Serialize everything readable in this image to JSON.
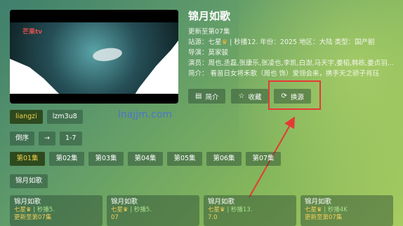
{
  "poster": {
    "channel_logo": "芒果tv"
  },
  "detail": {
    "title": "锦月如歌",
    "update": "更新至第07集",
    "meta_line": "站源：七星",
    "meta_rest": "| 秒播12.   年份：2025   地区：大陆   类型：国产剧",
    "director": "导演：莫家骏",
    "cast": "演员：周也,丞磊,张康乐,张凌也,李凯,白澍,马天宇,姜韬,韩栋,姜贞羽...",
    "intro": "简介：     看苗日女将禾歌（周也 饰）爱领会来，携手天之骄子肖珏"
  },
  "actions": [
    {
      "icon": "doc-icon",
      "glyph": "▤",
      "label": "简介"
    },
    {
      "icon": "star-icon",
      "glyph": "☆",
      "label": "收藏"
    },
    {
      "icon": "refresh-icon",
      "glyph": "⟳",
      "label": "换源"
    }
  ],
  "sources": [
    "liangzi",
    "lzm3u8"
  ],
  "watermark": "lnajjm.com",
  "sort": {
    "label": "倒序",
    "arrow": "→",
    "range": "1-7"
  },
  "episodes": [
    "第01集",
    "第02集",
    "第03集",
    "第04集",
    "第05集",
    "第06集",
    "第07集"
  ],
  "series_name": "锦月如歌",
  "cards": [
    {
      "title": "锦月如歌",
      "star_src": "七星",
      "rest_src": "| 秒播5.",
      "bottom": "更新至第07集"
    },
    {
      "title": "锦月如歌",
      "star_src": "七星",
      "rest_src": "| 秒播5.",
      "bottom": "07"
    },
    {
      "title": "锦月如歌",
      "star_src": "七星",
      "rest_src": "| 秒播13.",
      "bottom": "7.0"
    },
    {
      "title": "锦月如歌",
      "star_src": "七星",
      "rest_src": "| 秒播4K",
      "bottom": "更新至第07集"
    }
  ],
  "colors": {
    "accent": "#f2d04a",
    "annotation": "#e53935",
    "watermark": "#4a6edc"
  }
}
